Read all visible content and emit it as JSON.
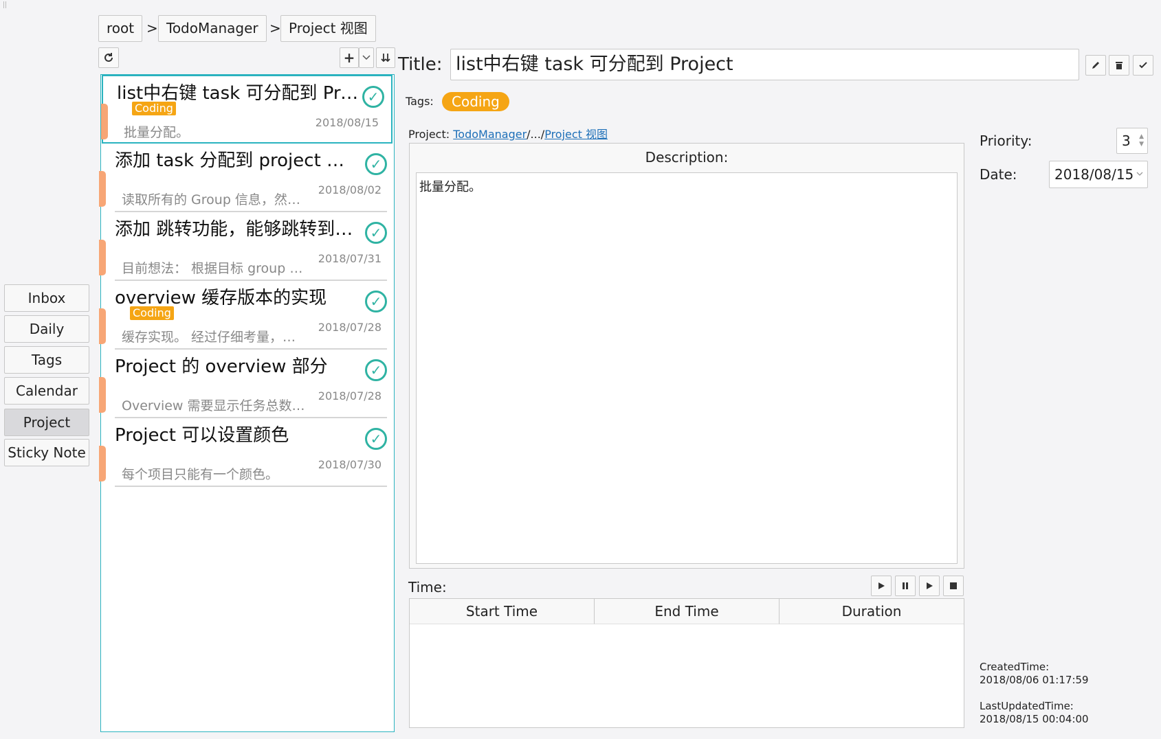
{
  "breadcrumb": {
    "items": [
      "root",
      "TodoManager",
      "Project 视图"
    ],
    "separator": ">"
  },
  "toolbar": {
    "refresh_icon": "refresh-icon",
    "add_label": "+",
    "dropdown_icon": "chevron-down-icon",
    "sort_icon": "sort-down-icon"
  },
  "sidebar": {
    "items": [
      {
        "label": "Inbox",
        "active": false
      },
      {
        "label": "Daily",
        "active": false
      },
      {
        "label": "Tags",
        "active": false
      },
      {
        "label": "Calendar",
        "active": false
      },
      {
        "label": "Project",
        "active": true
      },
      {
        "label": "Sticky Note",
        "active": false
      }
    ]
  },
  "tasks": [
    {
      "title": "list中右键 task 可分配到 Project",
      "tag": "Coding",
      "desc": "批量分配。",
      "date": "2018/08/15",
      "selected": true
    },
    {
      "title": "添加 task 分配到 project 的功能",
      "tag": "",
      "desc": "读取所有的 Group 信息，然后显示",
      "date": "2018/08/02",
      "selected": false
    },
    {
      "title": "添加 跳转功能，能够跳转到对应的 group",
      "tag": "",
      "desc": "目前想法： 根据目标 group 的路径",
      "date": "2018/07/31",
      "selected": false
    },
    {
      "title": "overview 缓存版本的实现",
      "tag": "Coding",
      "desc": "缓存实现。 经过仔细考量，决定",
      "date": "2018/07/28",
      "selected": false
    },
    {
      "title": "Project 的 overview 部分",
      "tag": "",
      "desc": "Overview 需要显示任务总数和完成数",
      "date": "2018/07/28",
      "selected": false
    },
    {
      "title": "Project 可以设置颜色",
      "tag": "",
      "desc": "每个项目只能有一个颜色。",
      "date": "2018/07/30",
      "selected": false
    }
  ],
  "detail": {
    "title_label": "Title:",
    "title_value": "list中右键 task 可分配到 Project",
    "tags_label": "Tags:",
    "tag": "Coding",
    "project_label": "Project:",
    "project_root": "TodoManager",
    "project_mid": "/.../",
    "project_leaf": "Project 视图",
    "description_label": "Description:",
    "description_text": "批量分配。",
    "time_label": "Time:",
    "columns": [
      "Start Time",
      "End Time",
      "Duration"
    ],
    "priority_label": "Priority:",
    "priority_value": "3",
    "date_label": "Date:",
    "date_value": "2018/08/15",
    "created_label": "CreatedTime:",
    "created_value": "2018/08/06 01:17:59",
    "updated_label": "LastUpdatedTime:",
    "updated_value": "2018/08/15 00:04:00"
  },
  "colors": {
    "accent": "#2ab3bf",
    "tag": "#f5a514",
    "check": "#2fb3a3",
    "stripe": "#f7a676"
  }
}
